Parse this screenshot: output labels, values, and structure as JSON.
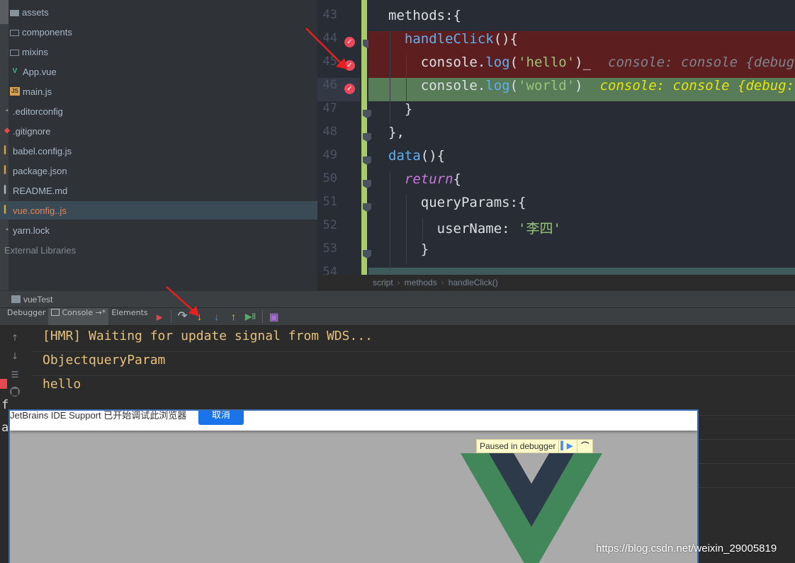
{
  "project_tree": {
    "items": [
      {
        "label": "assets",
        "icon": "folder-icon",
        "indent": 14
      },
      {
        "label": "components",
        "icon": "folder-icon",
        "indent": 14
      },
      {
        "label": "mixins",
        "icon": "folder-icon",
        "indent": 14
      },
      {
        "label": "App.vue",
        "icon": "vue-file-icon",
        "indent": 14
      },
      {
        "label": "main.js",
        "icon": "js-file-icon",
        "indent": 14
      },
      {
        "label": ".editorconfig",
        "icon": "config-file-icon",
        "indent": 8
      },
      {
        "label": ".gitignore",
        "icon": "git-file-icon",
        "indent": 8
      },
      {
        "label": "babel.config.js",
        "icon": "js-file-icon",
        "indent": 8
      },
      {
        "label": "package.json",
        "icon": "json-file-icon",
        "indent": 8
      },
      {
        "label": "README.md",
        "icon": "md-file-icon",
        "indent": 8
      },
      {
        "label": "vue.config..js",
        "icon": "js-file-icon",
        "indent": 8
      },
      {
        "label": "yarn.lock",
        "icon": "file-icon",
        "indent": 8
      },
      {
        "label": "External Libraries",
        "icon": "library-icon",
        "indent": 0
      }
    ],
    "selected_item": "vue.config..js"
  },
  "editor": {
    "top_partial_line": "},",
    "line_numbers": [
      "43",
      "44",
      "45",
      "46",
      "47",
      "48",
      "49",
      "50",
      "51",
      "52",
      "53"
    ],
    "breakpoint_lines": [
      "44",
      "45",
      "46"
    ],
    "lines": {
      "l43": {
        "t1": "methods:{"
      },
      "l44": {
        "t1": "handleClick",
        "t2": "(){"
      },
      "l45": {
        "t1": "console.",
        "t2": "log",
        "t3": "(",
        "t4": "'hello'",
        "t5": ")_",
        "hint": "console: console {debug: "
      },
      "l46": {
        "t1": "console.",
        "t2": "log",
        "t3": "(",
        "t4": "'world'",
        "t5": ")",
        "hint": "console: console {debug: "
      },
      "l47": {
        "t1": "}"
      },
      "l48": {
        "t1": "},"
      },
      "l49": {
        "t1": "data",
        "t2": "(){"
      },
      "l50": {
        "t1": "return",
        "t2": "{"
      },
      "l51": {
        "t1": "queryParams:{"
      },
      "l52": {
        "t1": "userName: ",
        "t2": "'李四'"
      },
      "l53": {
        "t1": "}"
      }
    },
    "colors": {
      "red_line": "#5c1e1e",
      "green_line": "#587b58",
      "breakpoint": "#e9485a",
      "git_change": "#a7cc6c"
    }
  },
  "breadcrumb": {
    "items": [
      "script",
      "methods",
      "handleClick()"
    ]
  },
  "run_window": {
    "title": "vueTest"
  },
  "debug_toolbar": {
    "tabs": [
      {
        "label": "Debugger"
      },
      {
        "label": "Console →*"
      },
      {
        "label": "Elements"
      }
    ],
    "buttons": [
      "rerun-icon",
      "step-over-icon",
      "step-into-icon",
      "force-step-into-icon",
      "step-out-icon",
      "run-to-cursor-icon",
      "evaluate-icon"
    ]
  },
  "console": {
    "lines": [
      "[HMR] Waiting for update signal from WDS...",
      "ObjectqueryParam",
      "hello"
    ]
  },
  "browser": {
    "infobar_message": "JetBrains IDE Support 已开始调试此浏览器",
    "cancel_label": "取消",
    "paused_label": "Paused in debugger"
  },
  "left_letters": [
    "f",
    "a"
  ],
  "watermark": "https://blog.csdn.net/weixin_29005819"
}
